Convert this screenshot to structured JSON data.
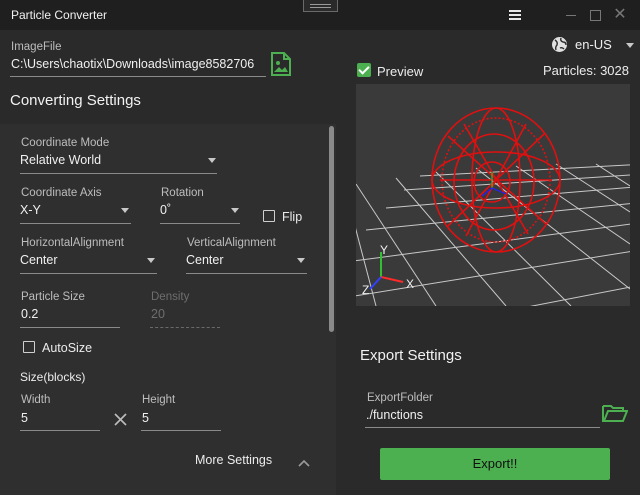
{
  "window": {
    "title": "Particle Converter"
  },
  "image_file": {
    "label": "ImageFile",
    "value": "C:\\Users\\chaotix\\Downloads\\image8582706"
  },
  "language": {
    "value": "en-US"
  },
  "settings": {
    "heading": "Converting Settings",
    "coordinate_mode": {
      "label": "Coordinate Mode",
      "value": "Relative World"
    },
    "coordinate_axis": {
      "label": "Coordinate Axis",
      "value": "X-Y"
    },
    "rotation": {
      "label": "Rotation",
      "value": "0˚"
    },
    "flip": {
      "label": "Flip",
      "checked": false
    },
    "horizontal_alignment": {
      "label": "HorizontalAlignment",
      "value": "Center"
    },
    "vertical_alignment": {
      "label": "VerticalAlignment",
      "value": "Center"
    },
    "particle_size": {
      "label": "Particle Size",
      "value": "0.2"
    },
    "density": {
      "label": "Density",
      "value": "20"
    },
    "autosize": {
      "label": "AutoSize",
      "checked": false
    },
    "size_blocks": {
      "label": "Size(blocks)"
    },
    "width": {
      "label": "Width",
      "value": "5"
    },
    "height": {
      "label": "Height",
      "value": "5"
    },
    "more_settings": "More Settings"
  },
  "preview": {
    "label": "Preview",
    "checked": true,
    "particles_text": "Particles: 3028",
    "axis_labels": {
      "x": "X",
      "y": "Y",
      "z": "Z"
    }
  },
  "export": {
    "heading": "Export Settings",
    "folder_label": "ExportFolder",
    "folder_value": "./functions",
    "button_label": "Export!!"
  },
  "colors": {
    "accent": "#4caf50",
    "particles": "#e01010"
  }
}
